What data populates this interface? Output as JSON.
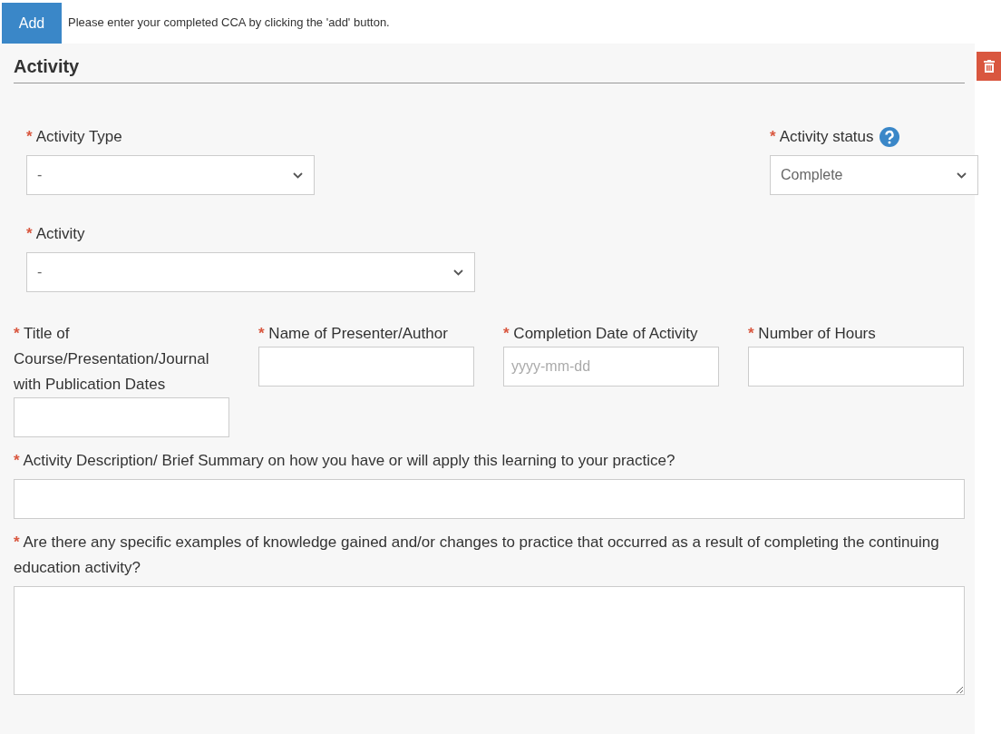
{
  "toolbar": {
    "add_button": "Add",
    "instruction": "Please enter your completed CCA by clicking the 'add' button."
  },
  "section": {
    "title": "Activity"
  },
  "top_fields": [
    {
      "kind": "select",
      "label": "Activity Type",
      "required_mark": "*",
      "value": "-",
      "help": false
    },
    {
      "kind": "select",
      "label": "Activity status",
      "required_mark": "*",
      "value": "Complete",
      "help": true
    },
    {
      "kind": "select",
      "label": "Activity",
      "required_mark": "*",
      "value": "-",
      "help": false
    }
  ],
  "row_fields": [
    {
      "kind": "text",
      "label": "Title of Course/Presentation/Journal with Publication Dates",
      "required_mark": "*"
    },
    {
      "kind": "text",
      "label": "Name of Presenter/Author",
      "required_mark": "*"
    },
    {
      "kind": "date",
      "label": "Completion Date of Activity",
      "required_mark": "*",
      "placeholder": "yyyy-mm-dd"
    },
    {
      "kind": "text",
      "label": "Number of Hours",
      "required_mark": "*"
    }
  ],
  "wide_fields": [
    {
      "kind": "text",
      "label": "Activity Description/ Brief Summary on how you have or will apply this learning to your practice?",
      "required_mark": "*"
    },
    {
      "kind": "textarea",
      "label": "Are there any specific examples of knowledge gained and/or changes to practice that occurred as a result of completing the continuing education activity?",
      "required_mark": "*"
    }
  ]
}
